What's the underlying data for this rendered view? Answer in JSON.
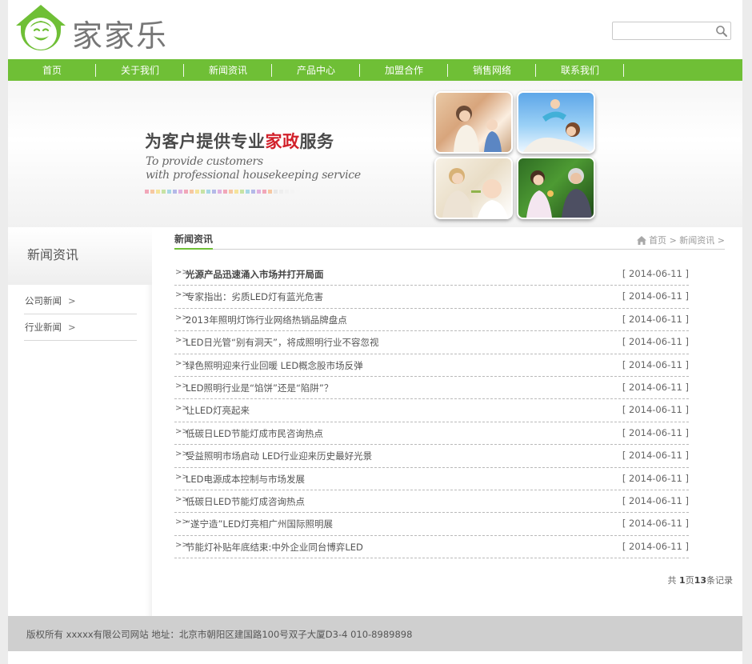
{
  "brand": {
    "name": "家家乐",
    "logo_icon": "smiley-house-logo",
    "accent": "#6fbf36"
  },
  "search": {
    "value": "",
    "placeholder": "",
    "icon": "search-icon"
  },
  "nav": {
    "items": [
      {
        "label": "首页"
      },
      {
        "label": "关于我们"
      },
      {
        "label": "新闻资讯"
      },
      {
        "label": "产品中心"
      },
      {
        "label": "加盟合作"
      },
      {
        "label": "销售网络"
      },
      {
        "label": "联系我们"
      }
    ]
  },
  "banner": {
    "title_pre": "为客户提供专业",
    "title_highlight": "家政",
    "title_post": "服务",
    "subtitle_line1": "To provide customers",
    "subtitle_line2": "with professional housekeeping service",
    "highlight_color": "#d2202a"
  },
  "sidebar": {
    "title": "新闻资讯",
    "items": [
      {
        "label": "公司新闻",
        "arrow": ">"
      },
      {
        "label": "行业新闻",
        "arrow": ">"
      }
    ]
  },
  "content": {
    "section_title": "新闻资讯",
    "breadcrumb": {
      "home": "首页",
      "sep": ">",
      "current": "新闻资讯",
      "trail": ">"
    },
    "bullet": ">>",
    "news": [
      {
        "title": "光源产品迅速涌入市场并打开局面",
        "date": "[ 2014-06-11 ]"
      },
      {
        "title": "专家指出：劣质LED灯有蓝光危害",
        "date": "[ 2014-06-11 ]"
      },
      {
        "title": "2013年照明灯饰行业网络热销品牌盘点",
        "date": "[ 2014-06-11 ]"
      },
      {
        "title": "LED日光管“别有洞天”，将成照明行业不容忽视",
        "date": "[ 2014-06-11 ]"
      },
      {
        "title": "绿色照明迎来行业回暖 LED概念股市场反弹",
        "date": "[ 2014-06-11 ]"
      },
      {
        "title": "LED照明行业是“馅饼”还是“陷阱”？",
        "date": "[ 2014-06-11 ]"
      },
      {
        "title": "让LED灯亮起来",
        "date": "[ 2014-06-11 ]"
      },
      {
        "title": "低碳日LED节能灯成市民咨询热点",
        "date": "[ 2014-06-11 ]"
      },
      {
        "title": "受益照明市场启动 LED行业迎来历史最好光景",
        "date": "[ 2014-06-11 ]"
      },
      {
        "title": "LED电源成本控制与市场发展",
        "date": "[ 2014-06-11 ]"
      },
      {
        "title": "低碳日LED节能灯成咨询热点",
        "date": "[ 2014-06-11 ]"
      },
      {
        "title": "“遂宁造”LED灯亮相广州国际照明展",
        "date": "[ 2014-06-11 ]"
      },
      {
        "title": "节能灯补贴年底结束:中外企业同台博弈LED",
        "date": "[ 2014-06-11 ]"
      }
    ],
    "pager": {
      "prefix": "共 ",
      "page": "1",
      "mid": "页",
      "count": "13",
      "suffix": "条记录"
    }
  },
  "footer": {
    "text": "版权所有 xxxxx有限公司网站 地址：北京市朝阳区建国路100号双子大厦D3-4 010-8989898"
  }
}
